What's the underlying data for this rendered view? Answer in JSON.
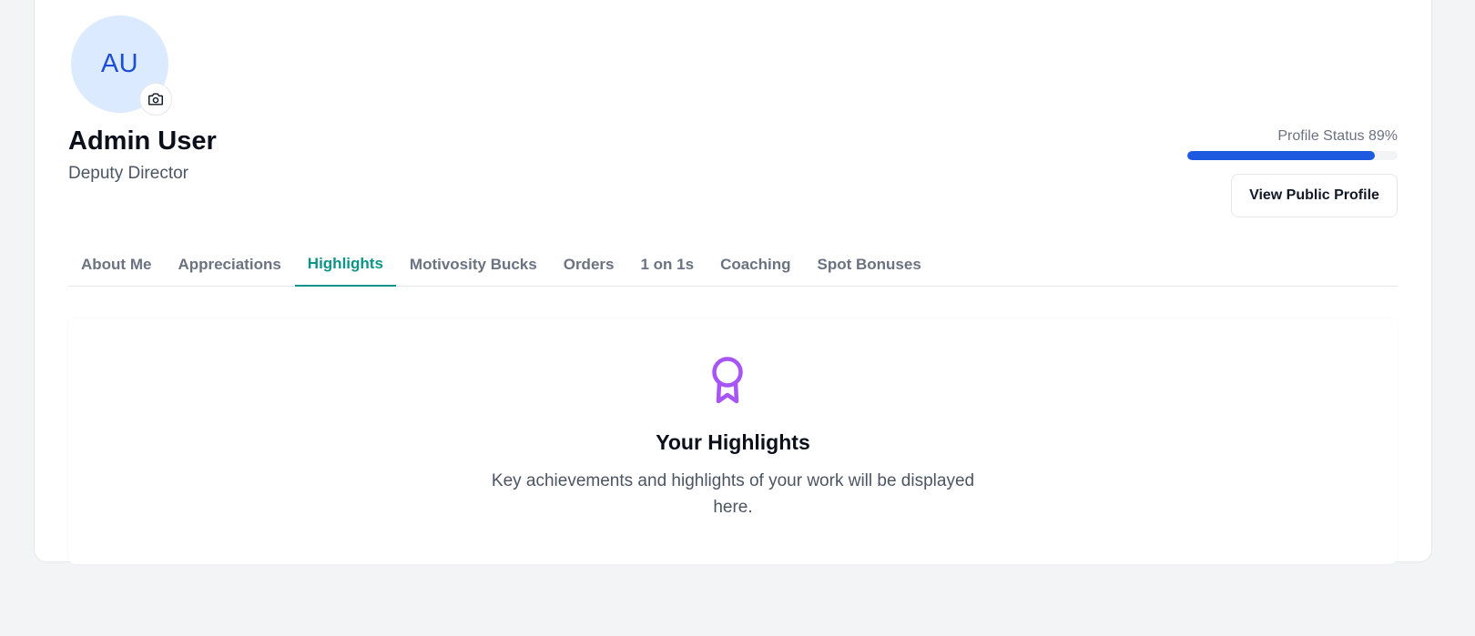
{
  "profile": {
    "avatar_initials": "AU",
    "camera_icon": "camera-icon",
    "name": "Admin User",
    "role": "Deputy Director",
    "status_label": "Profile Status 89%",
    "status_percent": 89,
    "view_public_label": "View Public Profile"
  },
  "tabs": [
    {
      "label": "About Me",
      "active": false
    },
    {
      "label": "Appreciations",
      "active": false
    },
    {
      "label": "Highlights",
      "active": true
    },
    {
      "label": "Motivosity Bucks",
      "active": false
    },
    {
      "label": "Orders",
      "active": false
    },
    {
      "label": "1 on 1s",
      "active": false
    },
    {
      "label": "Coaching",
      "active": false
    },
    {
      "label": "Spot Bonuses",
      "active": false
    }
  ],
  "highlights": {
    "icon": "award-ribbon-icon",
    "title": "Your Highlights",
    "description": "Key achievements and highlights of your work will be displayed here."
  },
  "colors": {
    "page_bg": "#f3f4f6",
    "avatar_bg": "#dbeafe",
    "avatar_text": "#1d4ed8",
    "progress": "#1d5ae0",
    "active_tab": "#0d9488",
    "ribbon": "#a855f7"
  }
}
